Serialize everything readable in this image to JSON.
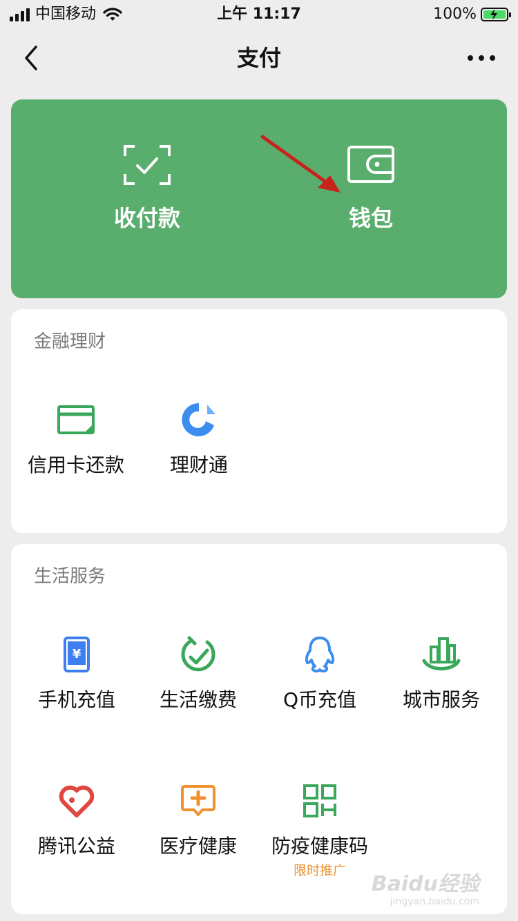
{
  "status_bar": {
    "carrier": "中国移动",
    "time": "上午 11:17",
    "battery": "100%"
  },
  "nav": {
    "title": "支付",
    "back_icon": "chevron-left-icon",
    "more_icon": "more-dots-icon"
  },
  "hero": {
    "background": "#5aae6d",
    "items": [
      {
        "label": "收付款",
        "icon": "scan-check-icon"
      },
      {
        "label": "钱包",
        "icon": "wallet-icon"
      }
    ],
    "annotation_arrow_color": "#c8221c"
  },
  "finance": {
    "title": "金融理财",
    "items": [
      {
        "label": "信用卡还款",
        "icon": "credit-card-icon",
        "color": "#3aa85a"
      },
      {
        "label": "理财通",
        "icon": "licaitong-icon",
        "color": "#3d8cf0"
      }
    ]
  },
  "life": {
    "title": "生活服务",
    "items": [
      {
        "label": "手机充值",
        "icon": "phone-recharge-icon",
        "color": "#3d7ef0"
      },
      {
        "label": "生活缴费",
        "icon": "utility-payment-icon",
        "color": "#3aa85a"
      },
      {
        "label": "Q币充值",
        "icon": "qq-penguin-icon",
        "color": "#3d8cf0"
      },
      {
        "label": "城市服务",
        "icon": "city-buildings-icon",
        "color": "#3aa85a"
      },
      {
        "label": "腾讯公益",
        "icon": "charity-heart-icon",
        "color": "#e0473f"
      },
      {
        "label": "医疗健康",
        "icon": "medical-cross-icon",
        "color": "#f0912e"
      },
      {
        "label": "防疫健康码",
        "icon": "qr-code-icon",
        "color": "#3aa85a",
        "sub": "限时推广"
      }
    ]
  },
  "watermark": {
    "main": "Baidu经验",
    "sub": "jingyan.baidu.com"
  }
}
